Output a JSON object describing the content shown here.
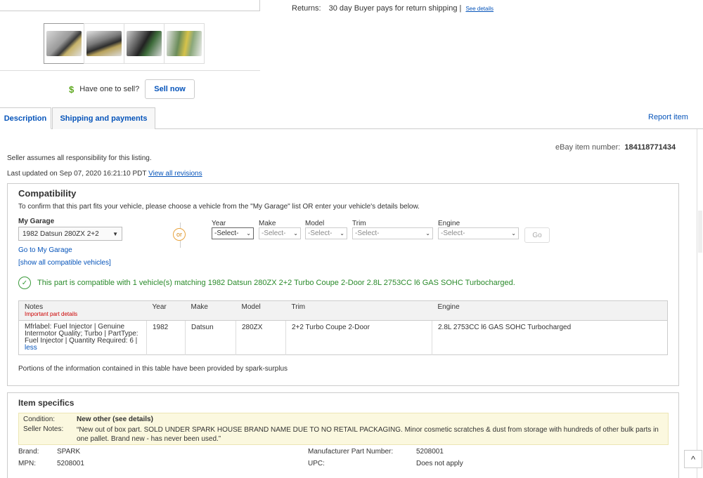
{
  "returns": {
    "label": "Returns:",
    "value": "30 day Buyer pays for return shipping |",
    "see_details": "See details"
  },
  "thumbnails": [
    "thumb-1",
    "thumb-2",
    "thumb-3",
    "thumb-4"
  ],
  "sell": {
    "dollar": "$",
    "prompt": "Have one to sell?",
    "button": "Sell now"
  },
  "tabs": {
    "description": "Description",
    "shipping": "Shipping and payments"
  },
  "report_item": "Report item",
  "item_number": {
    "label": "eBay item number:",
    "value": "184118771434"
  },
  "seller_note": "Seller assumes all responsibility for this listing.",
  "last_updated": {
    "label": "Last updated on",
    "value": "Sep 07, 2020 16:21:10 PDT",
    "link": "View all revisions"
  },
  "compatibility": {
    "title": "Compatibility",
    "intro": "To confirm that this part fits your vehicle, please choose a vehicle from the \"My Garage\" list OR enter your vehicle's details below.",
    "garage_label": "My Garage",
    "garage_value": "1982 Datsun 280ZX 2+2",
    "or": "or",
    "fields": {
      "year": {
        "label": "Year",
        "value": "-Select-"
      },
      "make": {
        "label": "Make",
        "value": "-Select-"
      },
      "model": {
        "label": "Model",
        "value": "-Select-"
      },
      "trim": {
        "label": "Trim",
        "value": "-Select-"
      },
      "engine": {
        "label": "Engine",
        "value": "-Select-"
      }
    },
    "go": "Go",
    "goto_garage": "Go to My Garage",
    "show_all": "[show all compatible vehicles]",
    "match_message": "This part is compatible with 1 vehicle(s) matching 1982 Datsun 280ZX 2+2 Turbo Coupe 2-Door 2.8L 2753CC l6 GAS SOHC Turbocharged.",
    "table": {
      "headers": {
        "notes": "Notes",
        "notes_sub": "Important part details",
        "year": "Year",
        "make": "Make",
        "model": "Model",
        "trim": "Trim",
        "engine": "Engine"
      },
      "row": {
        "notes": "Mfrlabel: Fuel Injector | Genuine Intermotor Quality; Turbo | PartType: Fuel Injector | Quantity Required: 6 |",
        "less": "less",
        "year": "1982",
        "make": "Datsun",
        "model": "280ZX",
        "trim": "2+2 Turbo Coupe 2-Door",
        "engine": "2.8L 2753CC l6 GAS SOHC Turbocharged"
      }
    },
    "portions": "Portions of the information contained in this table have been provided by spark-surplus"
  },
  "specifics": {
    "title": "Item specifics",
    "condition_label": "Condition:",
    "condition_value": "New other (see details)",
    "notes_label": "Seller Notes:",
    "notes_value": "“New out of box part. SOLD UNDER SPARK HOUSE BRAND NAME DUE TO NO RETAIL PACKAGING. Minor cosmetic scratches & dust from storage with hundreds of other bulk parts in one pallet. Brand new - has never been used.”",
    "brand_label": "Brand:",
    "brand_value": "SPARK",
    "mpn_label": "MPN:",
    "mpn_value": "5208001",
    "mfr_label": "Manufacturer Part Number:",
    "mfr_value": "5208001",
    "upc_label": "UPC:",
    "upc_value": "Does not apply"
  },
  "scroll_top": "^"
}
